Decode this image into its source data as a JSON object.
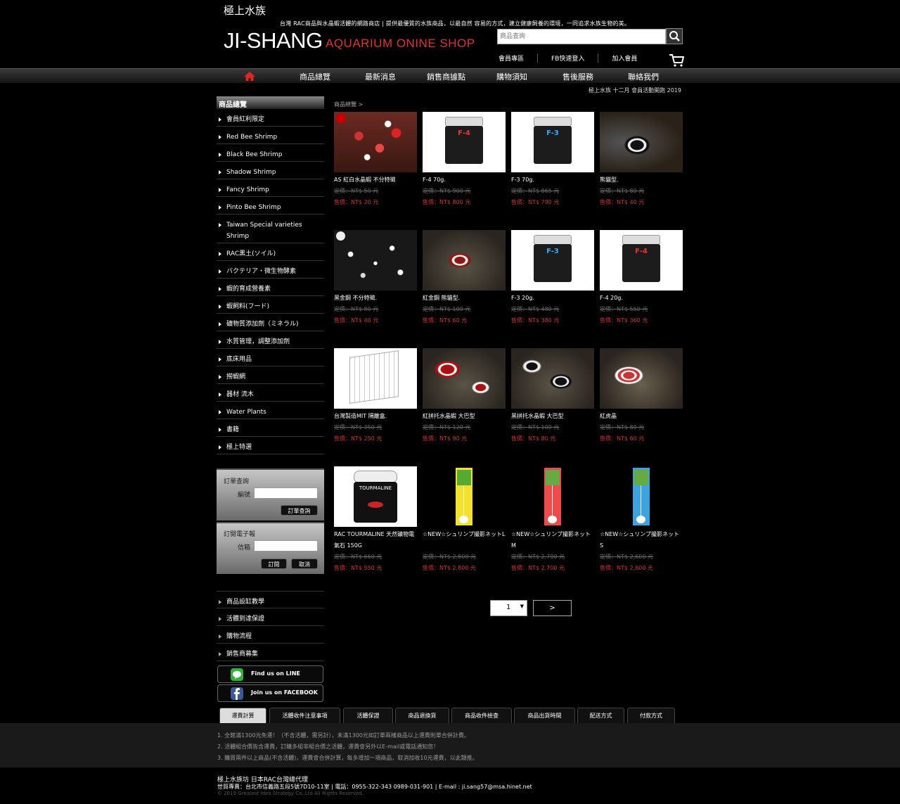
{
  "header": {
    "site_name": "極上水族",
    "slogan": "台灣 RAC商品與水晶蝦活體的網路商店 | 提供最優質的水族商品，以最自然 容易的方式，建立健康飼養的環境，一同追求水族生物的美。",
    "logo": "JI-SHANG",
    "logo_sub": "AQUARIUM  ONINE SHOP",
    "search_placeholder": "商品查詢",
    "links": [
      "會員專區",
      "FB快速登入",
      "加入會員"
    ]
  },
  "nav": [
    "商品總覽",
    "最新消息",
    "銷售商據點",
    "購物須知",
    "售後服務",
    "聯絡我們"
  ],
  "notice": "極上水族 十二月 會員活動開跑 2019",
  "breadcrumb": "商品總覽 >",
  "sidebar": {
    "title": "商品總覽",
    "items": [
      "會員紅利限定",
      "Red Bee Shrimp",
      "Black Bee Shrimp",
      "Shadow Shrimp",
      "Fancy Shrimp",
      "Pinto Bee Shrimp",
      "Taiwan Special varieties Shrimp",
      "RAC黑土(ソイル)",
      "バクテリア・微生物酵素",
      "蝦的育成營養素",
      "蝦飼料(フード)",
      "礦物質添加劑（ミネラル)",
      "水質管理，調整添加劑",
      "底床用品",
      "撈蝦網",
      "器材 流木",
      "Water Plants",
      "書籍",
      "極上特選"
    ],
    "order_query": {
      "title": "訂單查詢",
      "label": "編號",
      "button": "訂單查詢"
    },
    "newsletter": {
      "title": "訂閱電子報",
      "label": "信箱",
      "subscribe": "訂閱",
      "cancel": "取消"
    },
    "info_links": [
      "商品設缸教學",
      "活體到達保證",
      "購物流程",
      "銷售商募集"
    ],
    "social": [
      "Find us on LINE",
      "Join us on FACEBOOK"
    ]
  },
  "products": [
    {
      "name": "AS 紅白水晶蝦 不分特徵",
      "old": "定價：NT$ 50 元",
      "new": "售價：NT$ 20 元"
    },
    {
      "name": "F-4 70g.",
      "old": "定價：NT$ 900 元",
      "new": "售價：NT$ 800 元",
      "label": "F-4"
    },
    {
      "name": "F-3 70g.",
      "old": "定價：NT$ 865 元",
      "new": "售價：NT$ 790 元",
      "label": "F-3"
    },
    {
      "name": "熊貓型.",
      "old": "定價：NT$ 80 元",
      "new": "售價：NT$ 40 元"
    },
    {
      "name": "黑金鋼 不分特徵.",
      "old": "定價：NT$ 80 元",
      "new": "售價：NT$ 40 元"
    },
    {
      "name": "紅金鋼 熊貓型.",
      "old": "定價：NT$ 100 元",
      "new": "售價：NT$ 60 元"
    },
    {
      "name": "F-3 20g.",
      "old": "定價：NT$ 480 元",
      "new": "售價：NT$ 380 元",
      "label": "F-3"
    },
    {
      "name": "F-4 20g.",
      "old": "定價：NT$ 550 元",
      "new": "售價：NT$ 360 元",
      "label": "F-4"
    },
    {
      "name": "台灣製造MIT 隔離盒.",
      "old": "定價：NT$ 350 元",
      "new": "售價：NT$ 250 元"
    },
    {
      "name": "紅拼托水晶蝦 大巴型",
      "old": "定價：NT$ 120 元",
      "new": "售價：NT$ 90 元"
    },
    {
      "name": "黑拼托水晶蝦 大巴型",
      "old": "定價：NT$ 100 元",
      "new": "售價：NT$ 80 元"
    },
    {
      "name": "紅虎晶",
      "old": "定價：NT$ 80 元",
      "new": "售價：NT$ 60 元"
    },
    {
      "name": "RAC TOURMALINE 天然礦物電氣石 150G",
      "old": "定價：NT$ 660 元",
      "new": "售價：NT$ 550 元",
      "label": "TOURMALINE"
    },
    {
      "name": "☆NEW☆シュリンプ撮影ネットL",
      "old": "定價：NT$ 2,800 元",
      "new": "售價：NT$ 2,800 元"
    },
    {
      "name": "☆NEW☆シュリンプ撮影ネットM",
      "old": "定價：NT$ 2,700 元",
      "new": "售價：NT$ 2,700 元"
    },
    {
      "name": "☆NEW☆シュリンプ撮影ネットS",
      "old": "定價：NT$ 2,600 元",
      "new": "售價：NT$ 2,600 元"
    }
  ],
  "pager": {
    "page": "1",
    "next": ">"
  },
  "tabs": [
    "運費計算",
    "活體收件注意事項",
    "活體保證",
    "商品退換貨",
    "商品收件檢查",
    "商品出貨時間",
    "配送方式",
    "付款方式"
  ],
  "tab_content": [
    "1. 全館滿1300元免運！（不含活體，需另計），未滿1300元如訂單兩樣商品以上運費則單合併計費。",
    "2. 活體組合價皆含運費，訂購多組非組合價之活體，運費會另外以E-mail或電話通知您！",
    "3. 購買兩件以上商品(不含活體)，運費會合併計算，每多增加一項商品，取消加收10元運費，以此類推。"
  ],
  "footer": {
    "line1": "極上水族坊 日本RAC台灣總代理",
    "line2": "世貿專賣：台北市信義路五段5號7D10-11室 | 電話：0955-322-343 0989-031-901 | E-mail : ji.sang57@msa.hinet.net",
    "line3": "© 2019 Greatest Idea Strategy Co.,Ltd All Rights Reserved."
  }
}
